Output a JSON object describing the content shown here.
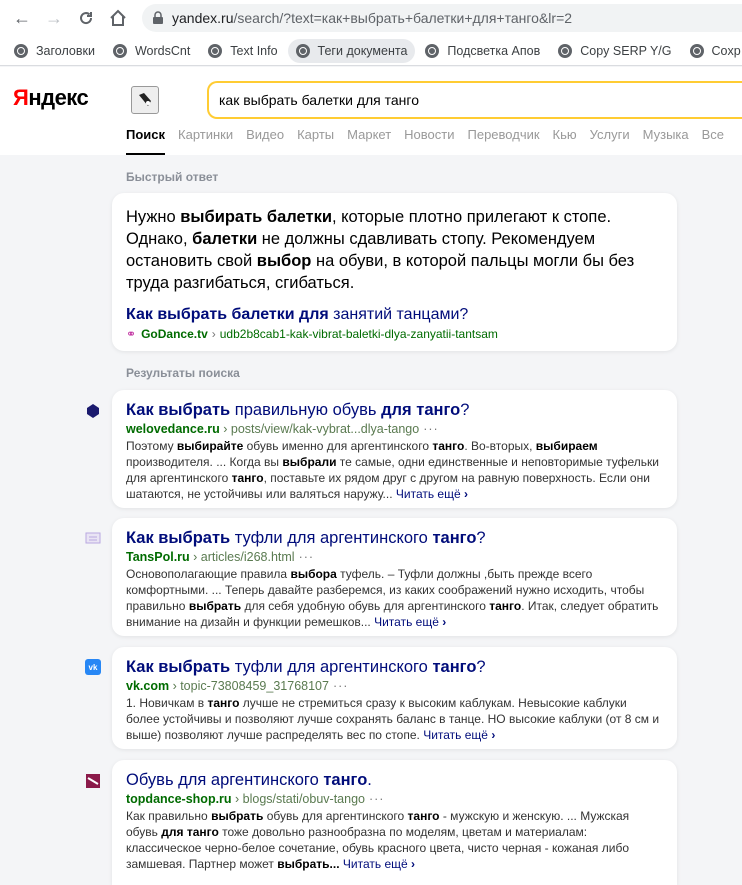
{
  "browser": {
    "url_host": "yandex.ru",
    "url_rest": "/search/?text=как+выбрать+балетки+для+танго&lr=2",
    "bookmarks": [
      "Заголовки",
      "WordsCnt",
      "Text Info",
      "Теги документа",
      "Подсветка Апов",
      "Copy SERP Y/G",
      "Coxp"
    ]
  },
  "header": {
    "logo_first": "Я",
    "logo_rest": "ндекс",
    "query": "как выбрать балетки для танго",
    "tabs": [
      "Поиск",
      "Картинки",
      "Видео",
      "Карты",
      "Маркет",
      "Новости",
      "Переводчик",
      "Кью",
      "Услуги",
      "Музыка",
      "Все"
    ]
  },
  "quick_answer": {
    "section_title": "Быстрый ответ",
    "text_parts": [
      {
        "t": "Нужно ",
        "b": false
      },
      {
        "t": "выбирать балетки",
        "b": true
      },
      {
        "t": ", которые плотно прилегают к стопе. Однако, ",
        "b": false
      },
      {
        "t": "балетки",
        "b": true
      },
      {
        "t": " не должны сдавливать стопу. Рекомендуем остановить свой ",
        "b": false
      },
      {
        "t": "выбор",
        "b": true
      },
      {
        "t": " на обуви, в которой пальцы могли бы без труда разгибаться, сгибаться.",
        "b": false
      }
    ],
    "link_bold": "Как выбрать балетки для",
    "link_rest": " занятий танцами?",
    "source_host": "GoDance.tv",
    "source_path": "udb2b8cab1-kak-vibrat-baletki-dlya-zanyatii-tantsam"
  },
  "results": {
    "section_title": "Результаты поиска",
    "more_label": "Читать ещё",
    "items": [
      {
        "title_parts": [
          {
            "t": "Как выбрать",
            "b": true
          },
          {
            "t": " правильную обувь ",
            "b": false
          },
          {
            "t": "для танго",
            "b": true
          },
          {
            "t": "?",
            "b": false
          }
        ],
        "host": "welovedance.ru",
        "path": "posts/view/kak-vybrat...dlya-tango",
        "snippet_parts": [
          {
            "t": "Поэтому ",
            "b": false
          },
          {
            "t": "выбирайте",
            "b": true
          },
          {
            "t": " обувь именно для аргентинского ",
            "b": false
          },
          {
            "t": "танго",
            "b": true
          },
          {
            "t": ". Во-вторых, ",
            "b": false
          },
          {
            "t": "выбираем",
            "b": true
          },
          {
            "t": " производителя. ... Когда вы ",
            "b": false
          },
          {
            "t": "выбрали",
            "b": true
          },
          {
            "t": " те самые, одни единственные и неповторимые туфельки для аргентинского ",
            "b": false
          },
          {
            "t": "танго",
            "b": true
          },
          {
            "t": ", поставьте их рядом друг с другом на равную поверхность. Если они шатаются, не устойчивы или валяться наружу... ",
            "b": false
          }
        ]
      },
      {
        "title_parts": [
          {
            "t": "Как выбрать",
            "b": true
          },
          {
            "t": " туфли для аргентинского ",
            "b": false
          },
          {
            "t": "танго",
            "b": true
          },
          {
            "t": "?",
            "b": false
          }
        ],
        "host": "TansPol.ru",
        "path": "articles/i268.html",
        "snippet_parts": [
          {
            "t": "Основополагающие правила ",
            "b": false
          },
          {
            "t": "выбора",
            "b": true
          },
          {
            "t": " туфель. – Туфли должны ,быть прежде всего комфортными. ... Теперь давайте разберемся, из каких соображений нужно исходить, чтобы правильно ",
            "b": false
          },
          {
            "t": "выбрать",
            "b": true
          },
          {
            "t": " для себя удобную обувь для аргентинского ",
            "b": false
          },
          {
            "t": "танго",
            "b": true
          },
          {
            "t": ". Итак, следует обратить внимание на дизайн и функции ремешков... ",
            "b": false
          }
        ]
      },
      {
        "title_parts": [
          {
            "t": "Как выбрать",
            "b": true
          },
          {
            "t": " туфли для аргентинского ",
            "b": false
          },
          {
            "t": "танго",
            "b": true
          },
          {
            "t": "?",
            "b": false
          }
        ],
        "host": "vk.com",
        "path": "topic-73808459_31768107",
        "snippet_parts": [
          {
            "t": "1. Новичкам в ",
            "b": false
          },
          {
            "t": "танго",
            "b": true
          },
          {
            "t": " лучше не стремиться сразу к высоким каблукам. Невысокие каблуки более устойчивы и позволяют лучше сохранять баланс в танце. НО высокие каблуки (от 8 см и выше) позволяют лучше распределять вес по стопе. ",
            "b": false
          }
        ]
      },
      {
        "title_parts": [
          {
            "t": "Обувь для аргентинского ",
            "b": false
          },
          {
            "t": "танго",
            "b": true
          },
          {
            "t": ".",
            "b": false
          }
        ],
        "host": "topdance-shop.ru",
        "path": "blogs/stati/obuv-tango",
        "snippet_parts": [
          {
            "t": "Как правильно ",
            "b": false
          },
          {
            "t": "выбрать",
            "b": true
          },
          {
            "t": " обувь для аргентинского ",
            "b": false
          },
          {
            "t": "танго",
            "b": true
          },
          {
            "t": " - мужскую и женскую. ... Мужская обувь ",
            "b": false
          },
          {
            "t": "для танго",
            "b": true
          },
          {
            "t": " тоже довольно разнообразна по моделям, цветам и материалам: классическое черно-белое сочетание, обувь красного цвета, чисто черная - кожаная либо замшевая. Партнер может ",
            "b": false
          },
          {
            "t": "выбрать...",
            "b": true
          },
          {
            "t": " ",
            "b": false
          }
        ]
      }
    ]
  },
  "colors": {
    "link": "#000c7a",
    "url_green": "#006b00",
    "search_border": "#ffcc33",
    "logo_red": "#ff0000"
  }
}
